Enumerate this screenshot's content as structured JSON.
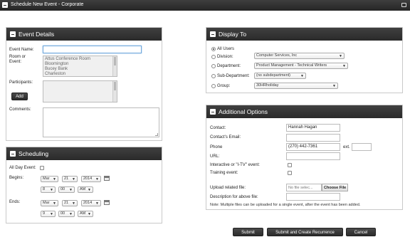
{
  "window": {
    "title": "Schedule New Event - Corporate"
  },
  "event_details": {
    "title": "Event Details",
    "event_name_label": "Event Name:",
    "event_name_value": "",
    "room_label": "Room or Event:",
    "rooms": [
      "Attus Conference Room",
      "Bloomington",
      "Bucey Bank",
      "Charleston"
    ],
    "participants_label": "Participants:",
    "add_button": "Add",
    "comments_label": "Comments:"
  },
  "scheduling": {
    "title": "Scheduling",
    "all_day_label": "All Day Event:",
    "begins_label": "Begins:",
    "ends_label": "Ends:",
    "begins": {
      "month": "Mar",
      "day": "21",
      "year": "2014",
      "hour": "8",
      "minute": "00",
      "ampm": "AM"
    },
    "ends": {
      "month": "Mar",
      "day": "21",
      "year": "2014",
      "hour": "9",
      "minute": "00",
      "ampm": "AM"
    }
  },
  "display_to": {
    "title": "Display To",
    "all_users": "All Users",
    "division_label": "Division:",
    "division_value": "Computer Services, Inc",
    "department_label": "Department:",
    "department_value": "Product Management - Technical Writers",
    "subdepartment_label": "Sub-Department:",
    "subdepartment_value": "(no subdepartment)",
    "group_label": "Group:",
    "group_value": "30HRholiday"
  },
  "additional_options": {
    "title": "Additional Options",
    "contact_label": "Contact:",
    "contact_value": "Hannah Hagan",
    "contact_email_label": "Contact's Email:",
    "contact_email_value": "",
    "phone_label": "Phone",
    "phone_value": "(270) 442-7361",
    "ext_label": "ext.",
    "ext_value": "",
    "url_label": "URL:",
    "url_value": "",
    "itv_label": "Interactive or \"I-TV\" event:",
    "training_label": "Training event:",
    "upload_label": "Upload related file:",
    "file_placeholder": "No file selec...",
    "choose_file": "Choose File",
    "description_label": "Description for above file:",
    "note": "Note: Multiple files can be uploaded for a single event, after the event has been added."
  },
  "actions": {
    "submit": "Submit",
    "submit_recurrence": "Submit and Create Recurrence",
    "cancel": "Cancel"
  }
}
